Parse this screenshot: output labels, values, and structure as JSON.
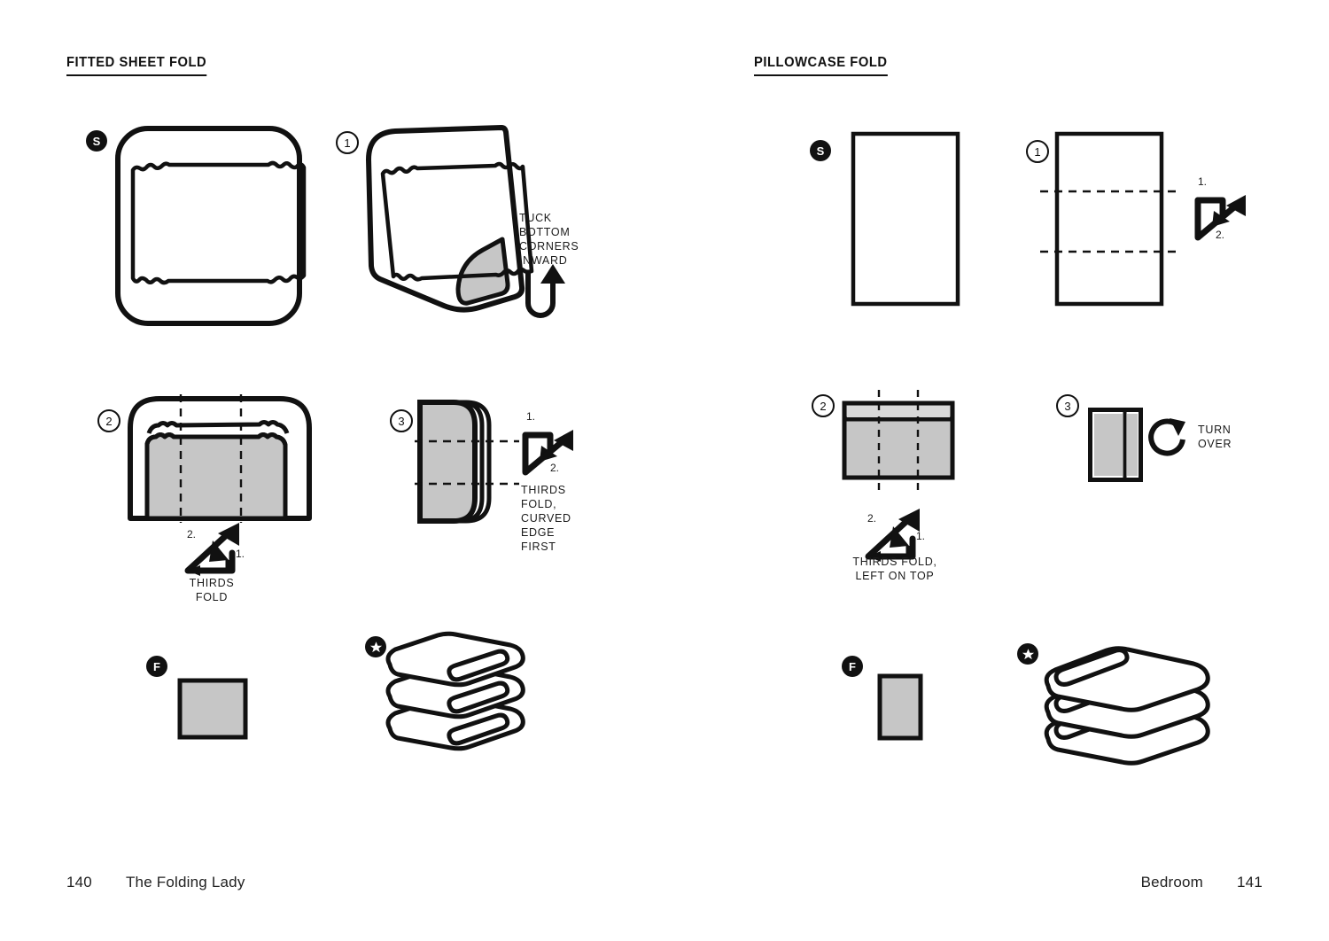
{
  "page": {
    "left_heading": "FITTED SHEET FOLD",
    "right_heading": "PILLOWCASE FOLD",
    "footer_left_page": "140",
    "footer_left_title": "The Folding Lady",
    "footer_right_section": "Bedroom",
    "footer_right_page": "141"
  },
  "badges": {
    "start": "S",
    "step1": "1",
    "step2": "2",
    "step3": "3",
    "flat": "F",
    "final_star": "star-icon"
  },
  "fitted_sheet": {
    "start_label": "S",
    "step1_label": "1",
    "step1_callout": "TUCK\nBOTTOM\nCORNERS\nINWARD",
    "step1_arrow": "u-turn-up-arrow",
    "step2_label": "2",
    "step2_arrow_num1": "1.",
    "step2_arrow_num2": "2.",
    "step2_callout": "THIRDS FOLD",
    "step3_label": "3",
    "step3_arrow_num1": "1.",
    "step3_arrow_num2": "2.",
    "step3_callout": "THIRDS\nFOLD,\nCURVED\nEDGE\nFIRST",
    "flat_label": "F",
    "final_label": "star-icon"
  },
  "pillowcase": {
    "start_label": "S",
    "step1_label": "1",
    "step1_arrow_num1": "1.",
    "step1_arrow_num2": "2.",
    "step2_label": "2",
    "step2_arrow_num1": "1.",
    "step2_arrow_num2": "2.",
    "step2_callout": "THIRDS FOLD,\nLEFT ON TOP",
    "step3_label": "3",
    "step3_callout": "TURN\nOVER",
    "step3_arrow": "rotate-clockwise-arrow",
    "flat_label": "F",
    "final_label": "star-icon"
  },
  "colors": {
    "ink": "#111111",
    "fill_gray": "#c6c6c6",
    "paper": "#ffffff"
  }
}
